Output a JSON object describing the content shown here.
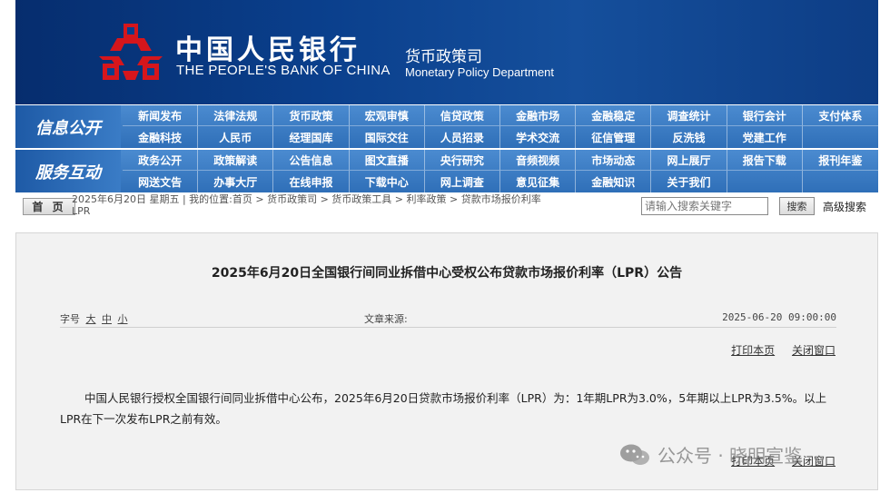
{
  "header": {
    "bank_name_cn": "中国人民银行",
    "bank_name_en": "THE PEOPLE'S BANK OF CHINA",
    "dept_cn": "货币政策司",
    "dept_en": "Monetary Policy Department"
  },
  "nav_info": {
    "title": "信息公开",
    "items": [
      "新闻发布",
      "法律法规",
      "货币政策",
      "宏观审慎",
      "信贷政策",
      "金融市场",
      "金融稳定",
      "调查统计",
      "银行会计",
      "支付体系",
      "金融科技",
      "人民币",
      "经理国库",
      "国际交往",
      "人员招录",
      "学术交流",
      "征信管理",
      "反洗钱",
      "党建工作",
      ""
    ]
  },
  "nav_service": {
    "title": "服务互动",
    "items": [
      "政务公开",
      "政策解读",
      "公告信息",
      "图文直播",
      "央行研究",
      "音频视频",
      "市场动态",
      "网上展厅",
      "报告下载",
      "报刊年鉴",
      "网送文告",
      "办事大厅",
      "在线申报",
      "下载中心",
      "网上调查",
      "意见征集",
      "金融知识",
      "关于我们",
      "",
      ""
    ]
  },
  "breadcrumb": {
    "home": "首 页",
    "line1": "2025年6月20日 星期五 | 我的位置:首页  >  货币政策司  >  货币政策工具  >  利率政策  >  贷款市场报价利率",
    "line2": "LPR"
  },
  "search": {
    "placeholder": "请输入搜索关键字",
    "button": "搜索",
    "advanced": "高级搜索"
  },
  "article": {
    "title": "2025年6月20日全国银行间同业拆借中心受权公布贷款市场报价利率（LPR）公告",
    "font_label": "字号",
    "font_large": "大",
    "font_medium": "中",
    "font_small": "小",
    "source_label": "文章来源:",
    "date": "2025-06-20 09:00:00",
    "print": "打印本页",
    "close": "关闭窗口",
    "body": "中国人民银行授权全国银行间同业拆借中心公布，2025年6月20日贷款市场报价利率（LPR）为：1年期LPR为3.0%，5年期以上LPR为3.5%。以上LPR在下一次发布LPR之前有效。"
  },
  "watermark": {
    "text": "公众号 · 晓明宣鉴"
  },
  "colors": {
    "banner": "#0a3f8c",
    "nav": "#3a7cc6",
    "logo_red": "#d6161c"
  }
}
